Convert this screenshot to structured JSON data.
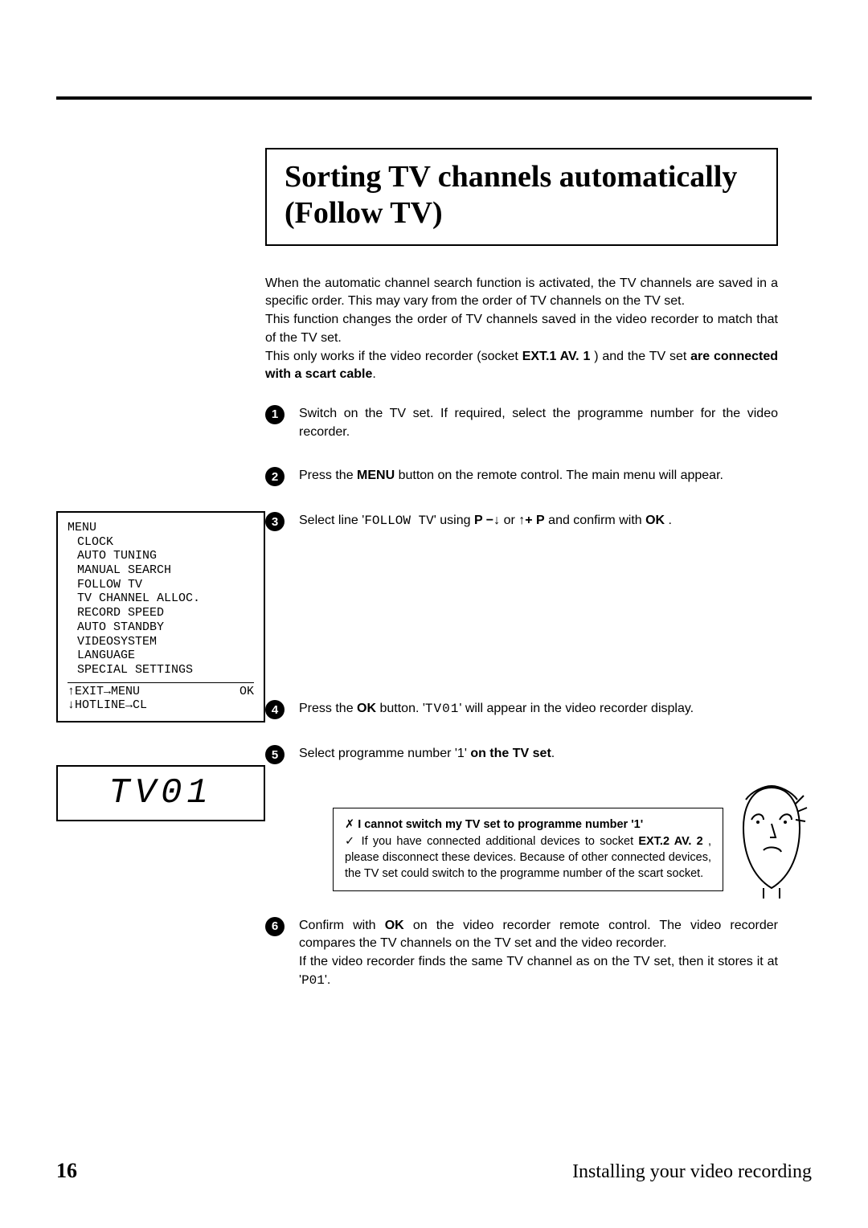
{
  "title": "Sorting TV channels automatically (Follow TV)",
  "intro": {
    "p1": "When the automatic channel search function is activated, the TV channels are saved in a specific order. This may vary from the order of TV channels on the TV set.",
    "p2": "This function changes the order of TV channels saved in the video recorder to match that of the TV set.",
    "p3_pre": "This only works if the video recorder (socket ",
    "p3_socket": "EXT.1 AV. 1",
    "p3_mid": " ) and the TV set ",
    "p3_bold": "are connected with a scart cable",
    "p3_post": "."
  },
  "steps": {
    "s1": "Switch on the TV set. If required, select the programme number for the video recorder.",
    "s2_pre": "Press the ",
    "s2_btn": "MENU",
    "s2_post": " button on the remote control. The main menu will appear.",
    "s3_pre": "Select line '",
    "s3_line": "FOLLOW TV",
    "s3_mid1": "' using ",
    "s3_k1": "P −",
    "s3_arr_dn": "↓",
    "s3_or": " or ",
    "s3_arr_up": "↑",
    "s3_k2": "+ P",
    "s3_mid2": " and confirm with ",
    "s3_ok": "OK",
    "s3_post": " .",
    "s4_pre": "Press the ",
    "s4_ok": "OK",
    "s4_mid": " button. '",
    "s4_disp": "TV01",
    "s4_post": "' will appear in the video recorder display.",
    "s5_pre": "Select programme number '1' ",
    "s5_bold": "on the TV set",
    "s5_post": ".",
    "s6_pre": "Confirm with ",
    "s6_ok": "OK",
    "s6_mid": " on the video recorder remote control. The video recorder compares the TV channels on the TV set and the video recorder.",
    "s6_p2_pre": "If the video recorder finds the same TV channel as on the TV set, then it stores it at '",
    "s6_p2_code": "P01",
    "s6_p2_post": "'."
  },
  "menu": {
    "title": "MENU",
    "items": [
      "CLOCK",
      "AUTO TUNING",
      "MANUAL SEARCH",
      "FOLLOW TV",
      "TV CHANNEL ALLOC.",
      "RECORD SPEED",
      "AUTO STANDBY",
      "VIDEOSYSTEM",
      "LANGUAGE",
      "SPECIAL SETTINGS"
    ],
    "footer_left_1": "↑EXIT→MENU",
    "footer_right_1": "OK",
    "footer_left_2": "↓HOTLINE→CL"
  },
  "display": "TV01",
  "note": {
    "title": "I cannot switch my TV set to programme number '1'",
    "body_pre": "If you have connected additional devices to socket ",
    "body_socket": "EXT.2 AV. 2",
    "body_post": " , please disconnect these devices. Because of other connected devices, the TV set could switch to the programme number of the scart socket."
  },
  "footer": {
    "page": "16",
    "section": "Installing your video recording"
  }
}
